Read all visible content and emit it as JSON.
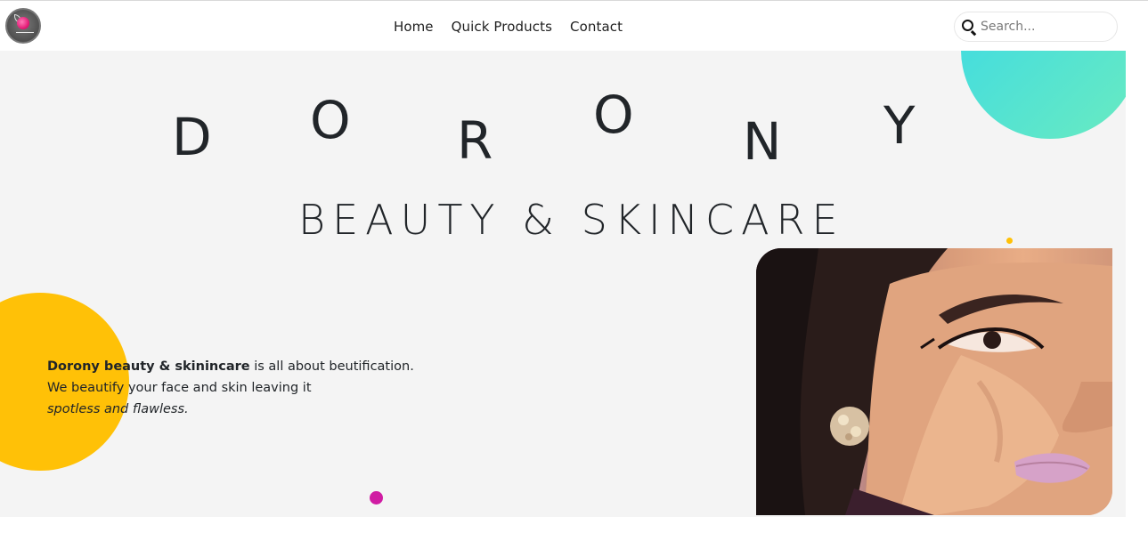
{
  "nav": {
    "links": [
      "Home",
      "Quick Products",
      "Contact"
    ],
    "search_placeholder": "Search..."
  },
  "hero": {
    "brand_letters": [
      "D",
      "O",
      "R",
      "O",
      "N",
      "Y"
    ],
    "subtitle": "BEAUTY & SKINCARE",
    "tagline": {
      "bold": "Dorony beauty & skinincare",
      "rest": " is all about beutification.",
      "line2": "We beautify your face and skin leaving it",
      "italic": "spotless and flawless."
    }
  },
  "colors": {
    "accent_yellow": "#ffc107",
    "accent_pink": "#d01ca3",
    "teal_start": "#3ad9e6",
    "teal_end": "#6aebc0",
    "hero_bg": "#f4f4f4"
  },
  "icons": {
    "search": "search-icon",
    "logo": "rose-logo"
  }
}
